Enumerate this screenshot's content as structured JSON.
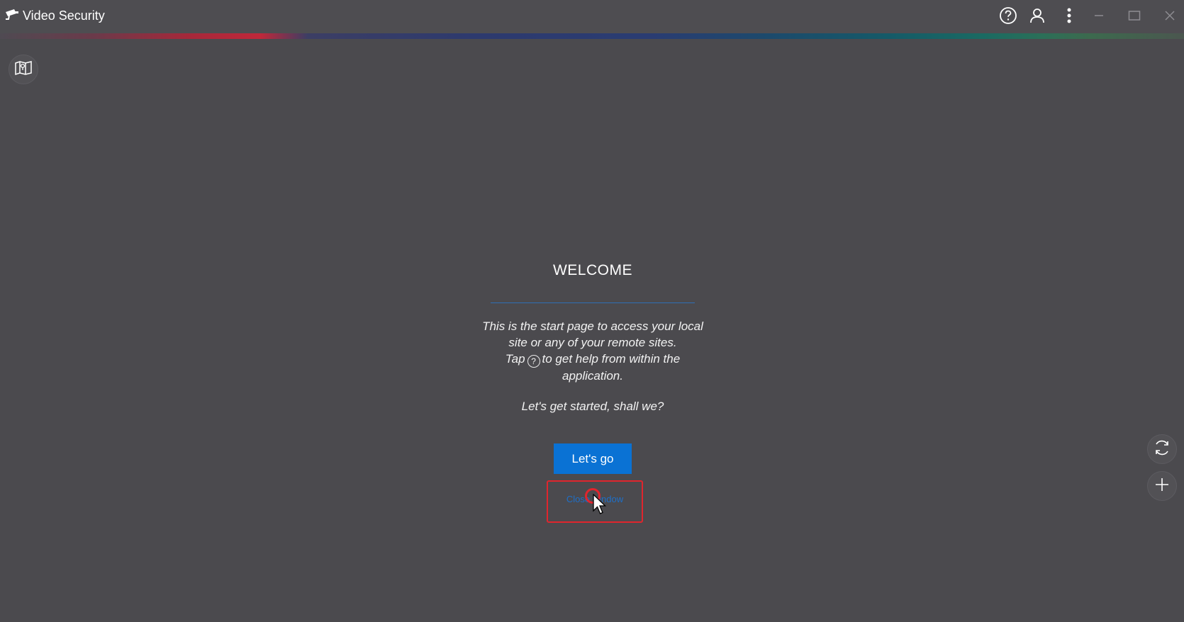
{
  "titlebar": {
    "app_name": "Video Security",
    "icons": [
      "camera-icon",
      "help-icon",
      "user-icon",
      "more-vert-icon",
      "minimize-icon",
      "maximize-icon",
      "close-icon"
    ]
  },
  "sidebar": {
    "map_icon": "map-icon"
  },
  "welcome": {
    "title": "WELCOME",
    "line1": "This is the start page to access your local",
    "line2": "site or any of your remote sites.",
    "line3_pre": "Tap",
    "line3_post": "to get help from within the",
    "line4": "application.",
    "help_glyph": "?",
    "started": "Let's get started, shall we?",
    "go_button": "Let's go",
    "close_link": "Close window"
  },
  "floating_buttons": {
    "icons": [
      "refresh-icon",
      "add-icon"
    ]
  },
  "colors": {
    "background": "#4b4a4e",
    "accent_blue": "#0a72d4",
    "highlight_red": "#e0252d",
    "divider_blue": "#2f6fb5"
  }
}
